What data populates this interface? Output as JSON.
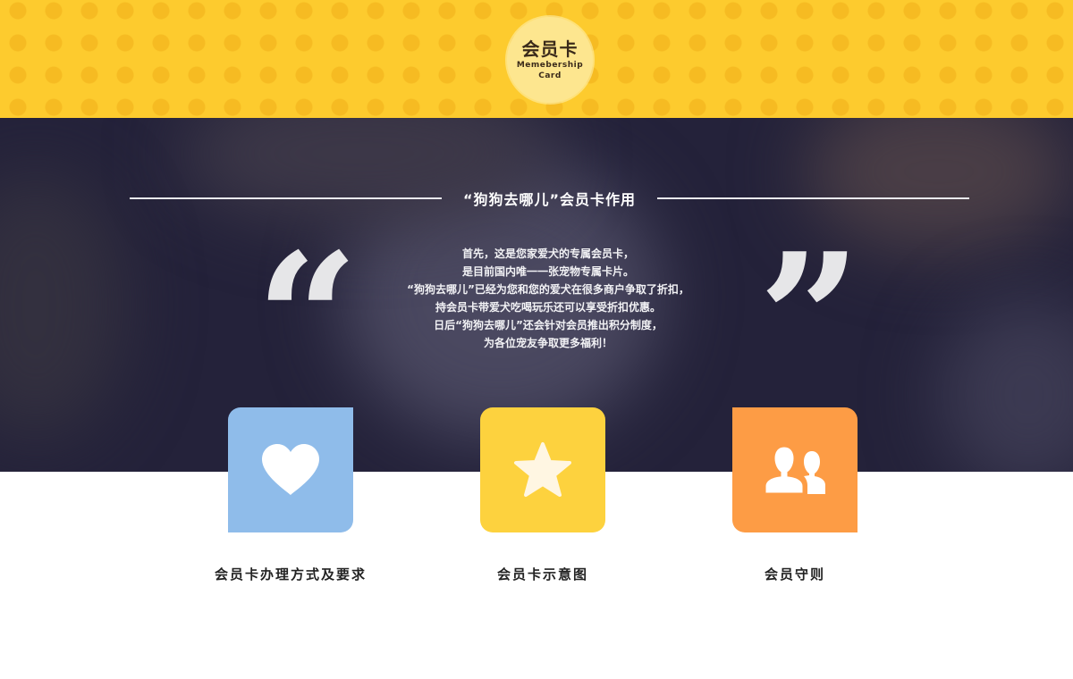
{
  "header": {
    "badge_title": "会员卡",
    "badge_subtitle": "Memebership Card"
  },
  "hero": {
    "section_title": "“狗狗去哪儿”会员卡作用",
    "quote_open": "“",
    "quote_close": "”",
    "paragraph_lines": [
      "首先，这是您家爱犬的专属会员卡，",
      "是目前国内唯一一张宠物专属卡片。",
      "“狗狗去哪儿”已经为您和您的爱犬在很多商户争取了折扣，",
      "持会员卡带爱犬吃喝玩乐还可以享受折扣优惠。",
      "日后“狗狗去哪儿”还会针对会员推出积分制度，",
      "为各位宠友争取更多福利！"
    ]
  },
  "features": [
    {
      "label": "会员卡办理方式及要求",
      "icon": "heart-icon",
      "color": "#8fbcea"
    },
    {
      "label": "会员卡示意图",
      "icon": "star-icon",
      "color": "#fdd23e"
    },
    {
      "label": "会员守则",
      "icon": "people-icon",
      "color": "#fd9c45"
    }
  ]
}
